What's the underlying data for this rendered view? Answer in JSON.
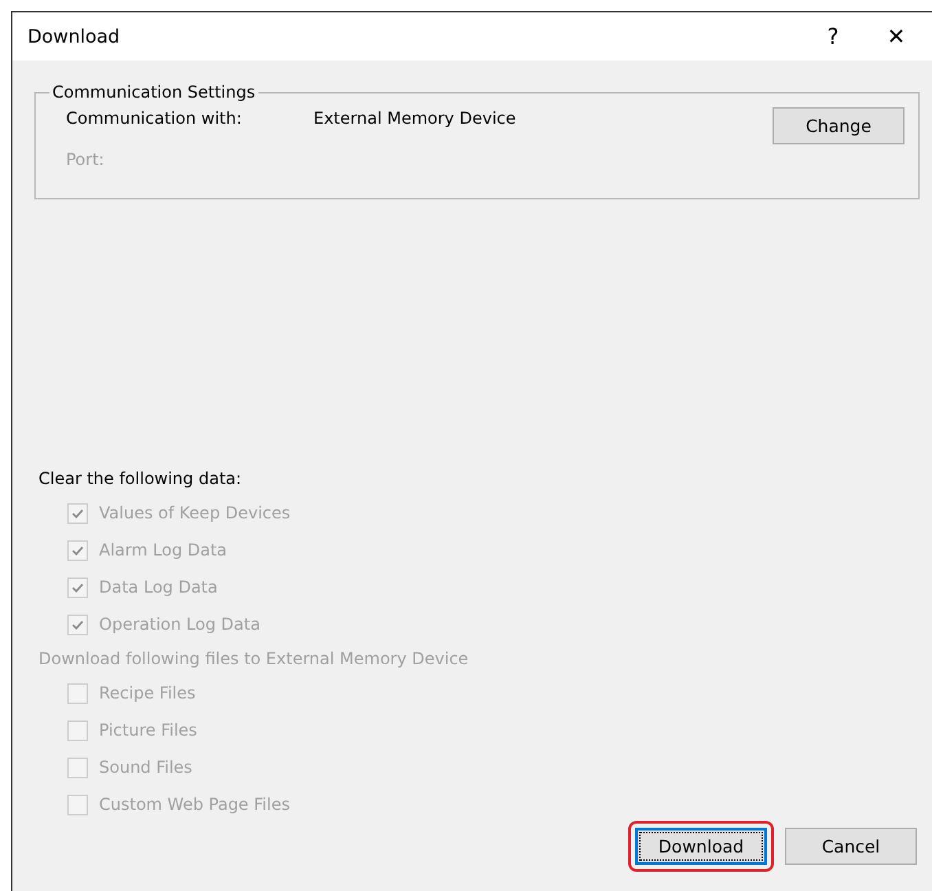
{
  "window": {
    "title": "Download",
    "help": "?",
    "close": "✕"
  },
  "communication_settings": {
    "title": "Communication Settings",
    "rows": [
      {
        "label": "Communication with:",
        "value": "External Memory Device",
        "disabled": false
      },
      {
        "label": "Port:",
        "disabled": true
      }
    ],
    "change_button": "Change"
  },
  "clear_section": {
    "label": "Clear the following data:",
    "disabled": false,
    "items": [
      {
        "label": "Values of Keep Devices",
        "checked": true,
        "disabled": true
      },
      {
        "label": "Alarm Log Data",
        "checked": true,
        "disabled": true
      },
      {
        "label": "Data Log Data",
        "checked": true,
        "disabled": true
      },
      {
        "label": "Operation Log Data",
        "checked": true,
        "disabled": true
      }
    ]
  },
  "files_section": {
    "label": "Download following files to External Memory Device",
    "disabled": true,
    "items": [
      {
        "label": "Recipe Files",
        "checked": false,
        "disabled": true
      },
      {
        "label": "Picture Files",
        "checked": false,
        "disabled": true
      },
      {
        "label": "Sound Files",
        "checked": false,
        "disabled": true
      },
      {
        "label": "Custom Web Page Files",
        "checked": false,
        "disabled": true
      }
    ]
  },
  "buttons": [
    {
      "label": "Download",
      "focused": true,
      "highlighted": true
    },
    {
      "label": "Cancel",
      "focused": false,
      "highlighted": false
    }
  ]
}
